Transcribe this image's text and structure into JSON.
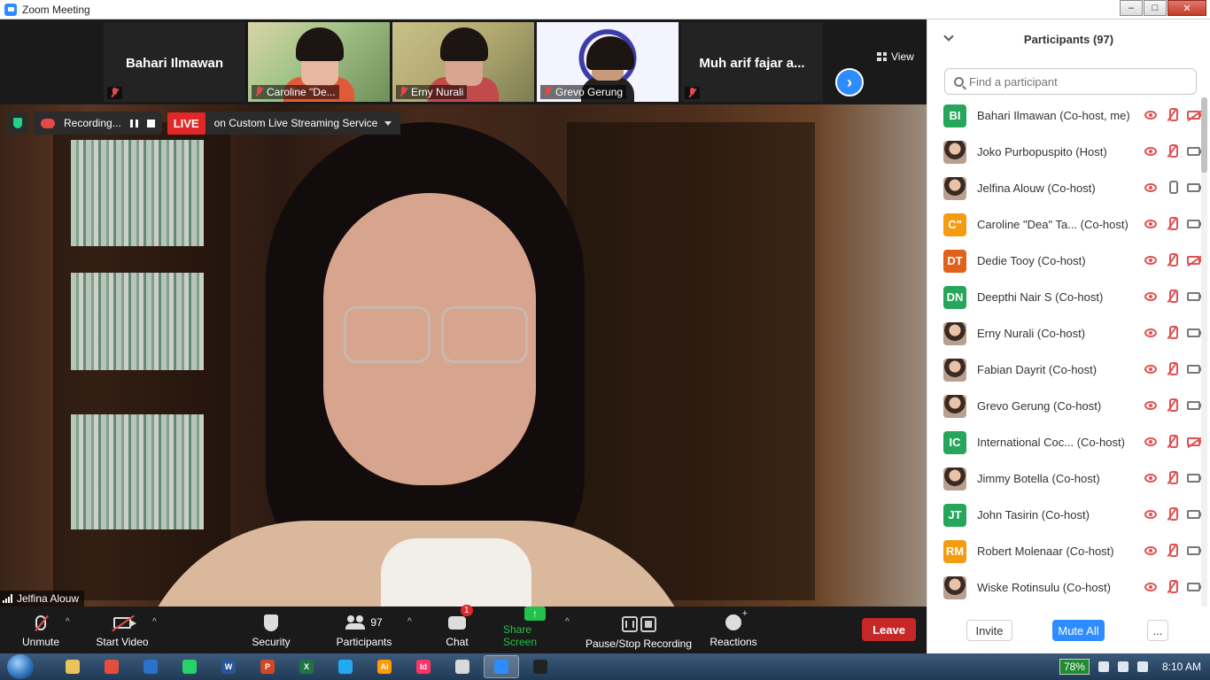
{
  "window": {
    "title": "Zoom Meeting",
    "minimize": "–",
    "maximize": "□",
    "close": "✕"
  },
  "gallery": {
    "tiles": [
      {
        "name": "Bahari Ilmawan",
        "label": ""
      },
      {
        "name": "",
        "label": "Caroline \"De..."
      },
      {
        "name": "",
        "label": "Erny Nurali"
      },
      {
        "name": "",
        "label": "Grevo Gerung"
      },
      {
        "name": "Muh arif fajar a...",
        "label": ""
      }
    ],
    "view_label": "View",
    "next_label": "›"
  },
  "recording": {
    "status": "Recording...",
    "live_badge": "LIVE",
    "live_service": "on Custom Live Streaming Service"
  },
  "active_speaker": "Jelfina Alouw",
  "toolbar": {
    "unmute": "Unmute",
    "start_video": "Start Video",
    "security": "Security",
    "participants": "Participants",
    "participants_count": "97",
    "chat": "Chat",
    "chat_badge": "1",
    "share_screen": "Share Screen",
    "share_arrow": "↑",
    "pause_stop_recording": "Pause/Stop Recording",
    "reactions": "Reactions",
    "leave": "Leave"
  },
  "panel": {
    "title": "Participants (97)",
    "search_placeholder": "Find a participant",
    "participants": [
      {
        "initials": "BI",
        "color": "#26a65b",
        "name": "Bahari Ilmawan (Co-host, me)",
        "mic": "off",
        "cam": "off"
      },
      {
        "initials": "",
        "color": "",
        "name": "Joko Purbopuspito (Host)",
        "mic": "off",
        "cam": "on"
      },
      {
        "initials": "",
        "color": "",
        "name": "Jelfina Alouw (Co-host)",
        "mic": "on",
        "cam": "on"
      },
      {
        "initials": "C\"",
        "color": "#f39c12",
        "name": "Caroline \"Dea\" Ta... (Co-host)",
        "mic": "off",
        "cam": "on"
      },
      {
        "initials": "DT",
        "color": "#e0601c",
        "name": "Dedie Tooy (Co-host)",
        "mic": "off",
        "cam": "off"
      },
      {
        "initials": "DN",
        "color": "#26a65b",
        "name": "Deepthi Nair S (Co-host)",
        "mic": "off",
        "cam": "on"
      },
      {
        "initials": "",
        "color": "",
        "name": "Erny Nurali (Co-host)",
        "mic": "off",
        "cam": "on"
      },
      {
        "initials": "",
        "color": "",
        "name": "Fabian Dayrit (Co-host)",
        "mic": "off",
        "cam": "on"
      },
      {
        "initials": "",
        "color": "",
        "name": "Grevo Gerung (Co-host)",
        "mic": "off",
        "cam": "on"
      },
      {
        "initials": "IC",
        "color": "#26a65b",
        "name": "International Coc...  (Co-host)",
        "mic": "off",
        "cam": "off"
      },
      {
        "initials": "",
        "color": "",
        "name": "Jimmy Botella (Co-host)",
        "mic": "off",
        "cam": "on"
      },
      {
        "initials": "JT",
        "color": "#26a65b",
        "name": "John Tasirin (Co-host)",
        "mic": "off",
        "cam": "on"
      },
      {
        "initials": "RM",
        "color": "#f39c12",
        "name": "Robert Molenaar (Co-host)",
        "mic": "off",
        "cam": "on"
      },
      {
        "initials": "",
        "color": "",
        "name": "Wiske Rotinsulu (Co-host)",
        "mic": "off",
        "cam": "on"
      }
    ],
    "invite": "Invite",
    "mute_all": "Mute All",
    "more": "..."
  },
  "taskbar": {
    "battery": "78%",
    "time": "8:10 AM",
    "apps": [
      "explorer",
      "chrome",
      "outlook",
      "whatsapp",
      "word",
      "powerpoint",
      "excel",
      "vscode",
      "illustrator",
      "indesign",
      "paint",
      "zoom",
      "acrobat"
    ],
    "app_colors": [
      "#e8c45a",
      "#e84c3d",
      "#2a72c9",
      "#25d366",
      "#2b579a",
      "#d24726",
      "#217346",
      "#23a9f2",
      "#ff9a00",
      "#ff3366",
      "#d9d9d9",
      "#2d8cff",
      "#222"
    ],
    "app_letters": [
      "",
      "",
      "",
      "",
      "W",
      "P",
      "X",
      "",
      "Ai",
      "Id",
      "",
      "",
      ""
    ]
  }
}
